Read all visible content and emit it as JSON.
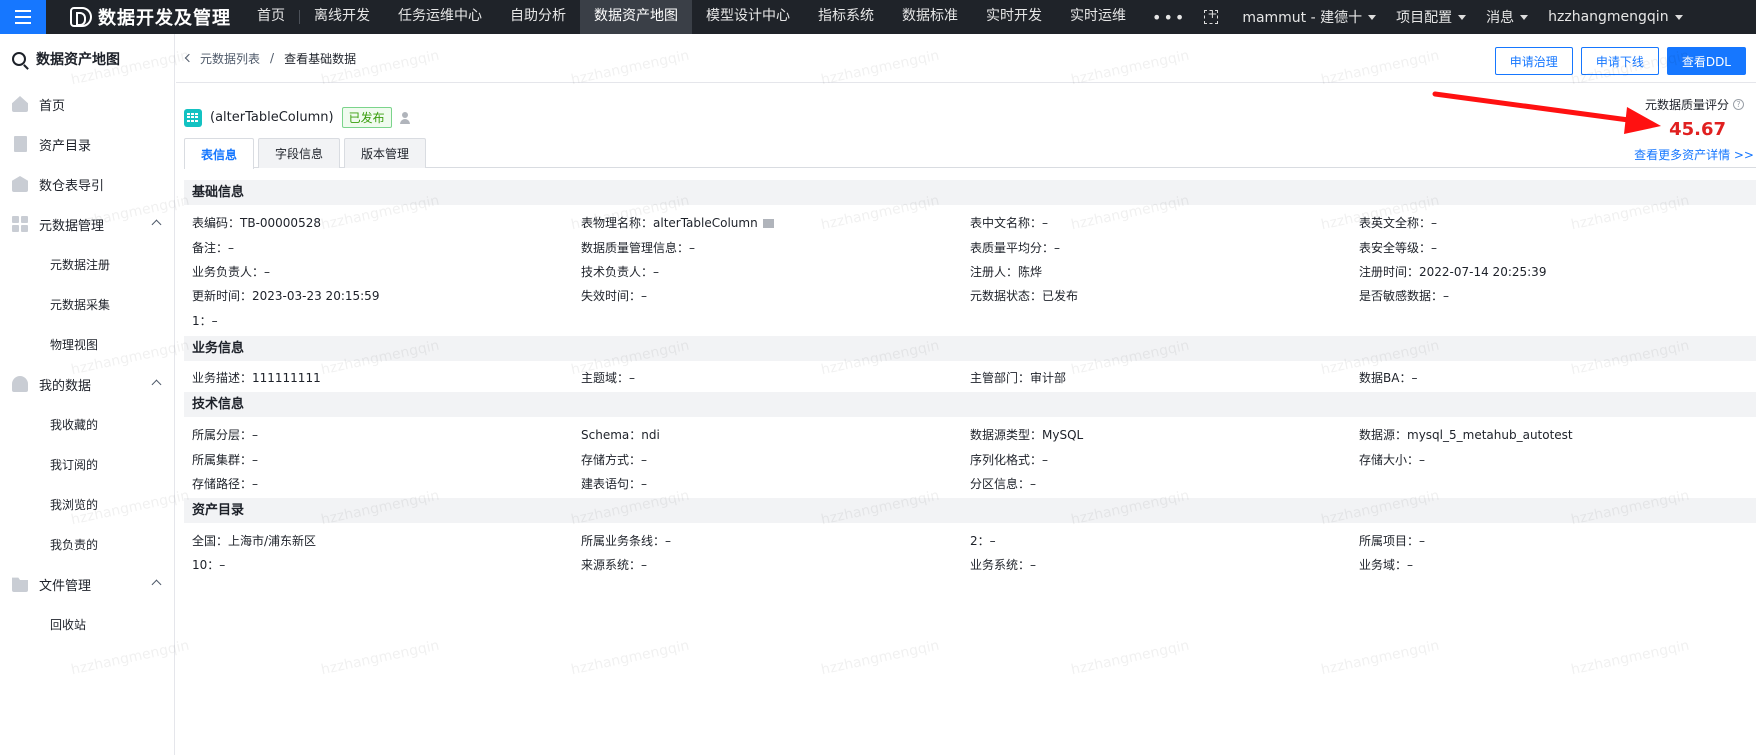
{
  "topbar": {
    "brand": "数据开发及管理",
    "nav": [
      "首页",
      "离线开发",
      "任务运维中心",
      "自助分析",
      "数据资产地图",
      "模型设计中心",
      "指标系统",
      "数据标准",
      "实时开发",
      "实时运维"
    ],
    "active_index": 4,
    "more": "•••",
    "project": "mammut - 建德十",
    "project_config": "项目配置",
    "messages": "消息",
    "user": "hzzhangmengqin"
  },
  "sidebar": {
    "title": "数据资产地图",
    "items": {
      "home": "首页",
      "catalog": "资产目录",
      "dw_guide": "数仓表导引",
      "meta_mgmt": "元数据管理",
      "meta_register": "元数据注册",
      "meta_collect": "元数据采集",
      "physical_view": "物理视图",
      "my_data": "我的数据",
      "my_favorites": "我收藏的",
      "my_subscribed": "我订阅的",
      "my_browsed": "我浏览的",
      "my_owned": "我负责的",
      "file_mgmt": "文件管理",
      "recycle": "回收站"
    }
  },
  "breadcrumb": {
    "back": "元数据列表",
    "sep": "/",
    "current": "查看基础数据"
  },
  "buttons": {
    "apply_govern": "申请治理",
    "apply_offline": "申请下线",
    "view_ddl": "查看DDL"
  },
  "table": {
    "name": "(alterTableColumn)",
    "status": "已发布"
  },
  "score": {
    "label": "元数据质量评分",
    "value": "45.67"
  },
  "tabs": [
    "表信息",
    "字段信息",
    "版本管理"
  ],
  "more_link": "查看更多资产详情 >>",
  "watermark": "hzzhangmengqin",
  "sections": {
    "basic": {
      "title": "基础信息",
      "rows": [
        [
          "表编码：TB-00000528",
          "表物理名称：alterTableColumn",
          "表中文名称：–",
          "表英文全称：–"
        ],
        [
          "备注：–",
          "数据质量管理信息：–",
          "表质量平均分：–",
          "表安全等级：–"
        ],
        [
          "业务负责人：–",
          "技术负责人：–",
          "注册人：陈烨",
          "注册时间：2022-07-14 20:25:39"
        ],
        [
          "更新时间：2023-03-23 20:15:59",
          "失效时间：–",
          "元数据状态：已发布",
          "是否敏感数据：–"
        ],
        [
          "1：–",
          "",
          "",
          ""
        ]
      ]
    },
    "business": {
      "title": "业务信息",
      "rows": [
        [
          "业务描述：111111111",
          "主题域：–",
          "主管部门：审计部",
          "数据BA：–"
        ]
      ]
    },
    "tech": {
      "title": "技术信息",
      "rows": [
        [
          "所属分层：–",
          "Schema：ndi",
          "数据源类型：MySQL",
          "数据源：mysql_5_metahub_autotest"
        ],
        [
          "所属集群：–",
          "存储方式：–",
          "序列化格式：–",
          "存储大小：–"
        ],
        [
          "存储路径：–",
          "建表语句：–",
          "分区信息：–",
          ""
        ]
      ]
    },
    "catalog": {
      "title": "资产目录",
      "rows": [
        [
          "全国：上海市/浦东新区",
          "所属业务条线：–",
          "2：–",
          "所属项目：–"
        ],
        [
          "10：–",
          "来源系统：–",
          "业务系统：–",
          "业务域：–"
        ]
      ]
    }
  }
}
